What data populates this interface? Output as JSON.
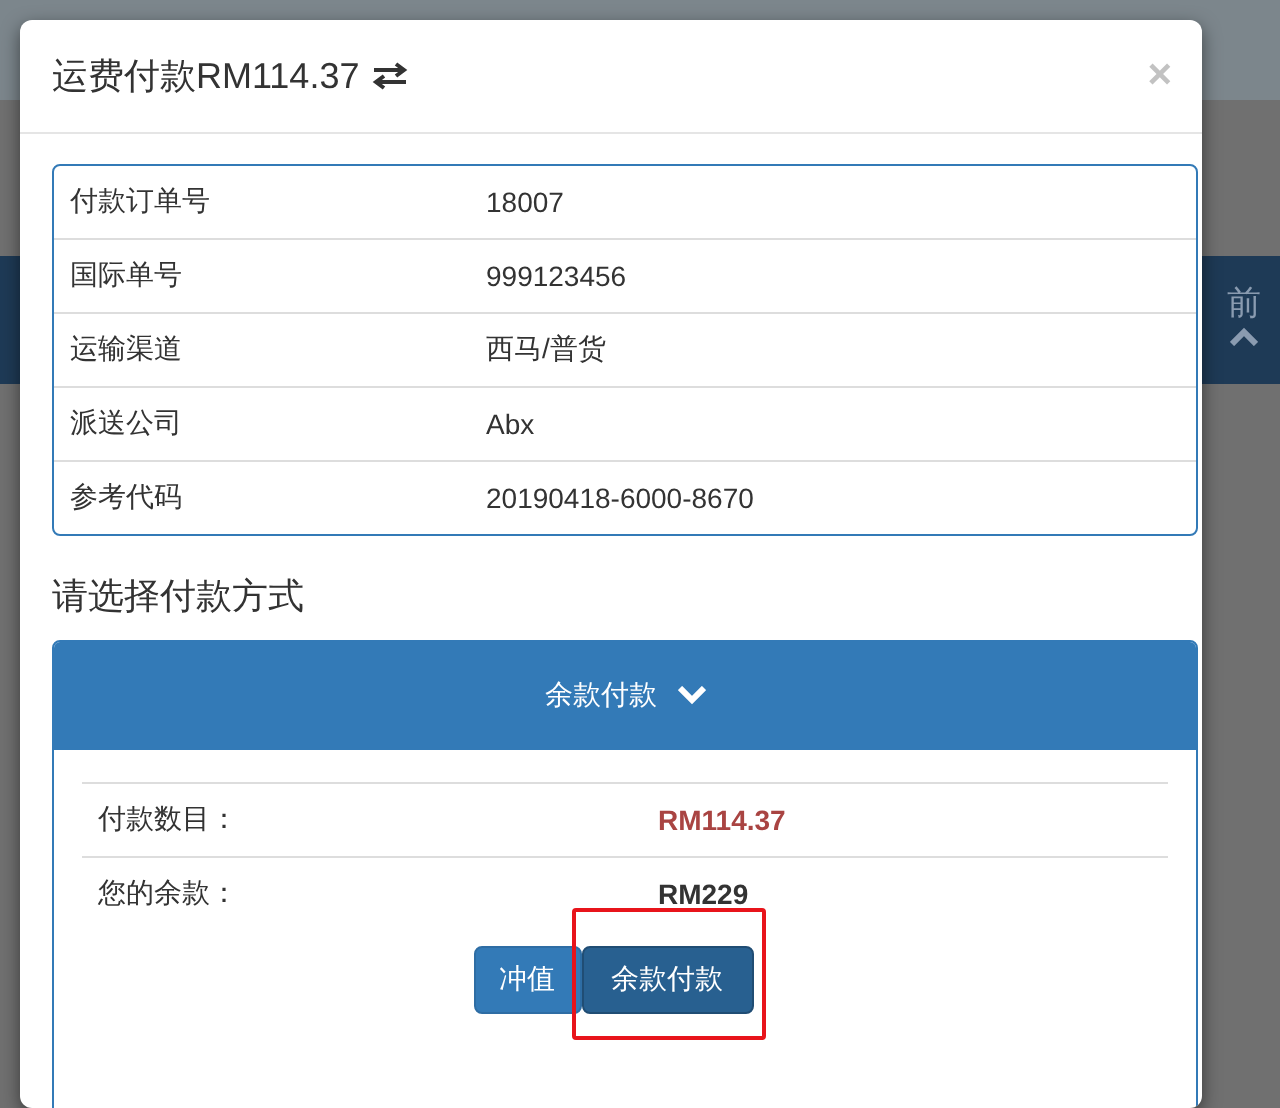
{
  "background": {
    "side_label": "前"
  },
  "dialog": {
    "title": "运费付款RM114.37",
    "close": "×",
    "details": [
      {
        "label": "付款订单号",
        "value": "18007"
      },
      {
        "label": "国际单号",
        "value": "999123456"
      },
      {
        "label": "运输渠道",
        "value": "西马/普货"
      },
      {
        "label": "派送公司",
        "value": "Abx"
      },
      {
        "label": "参考代码",
        "value": "20190418-6000-8670"
      }
    ],
    "section_title": "请选择付款方式",
    "payment_panel": {
      "title": "余款付款",
      "expanded": true,
      "rows": [
        {
          "label": "付款数目：",
          "value": "RM114.37",
          "kind": "due"
        },
        {
          "label": "您的余款：",
          "value": "RM229",
          "kind": "balance"
        }
      ],
      "buttons": [
        {
          "label": "冲值",
          "active": false,
          "highlighted": false
        },
        {
          "label": "余款付款",
          "active": true,
          "highlighted": true
        }
      ]
    }
  }
}
